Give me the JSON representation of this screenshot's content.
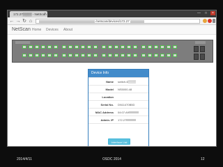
{
  "browser": {
    "tab_title": "172.27▒▒▒▒ - NetScan",
    "tab_close": "×",
    "window_controls": [
      "—",
      "□",
      "×"
    ],
    "back": "←",
    "forward": "→",
    "reload": "↻",
    "home": "⌂",
    "url": "/netscan/devices/172.27"
  },
  "navbar": {
    "brand": "NetScan",
    "links": [
      "Home",
      "Devices",
      "About"
    ]
  },
  "switch": {
    "left_label": "▒▒▒▒▒▒▒▒▒▒",
    "right_label": "▒▒▒▒▒▒▒"
  },
  "panel": {
    "title": "Device Info",
    "rows": [
      {
        "key": "Name",
        "value": "switch-6▒▒▒▒"
      },
      {
        "key": "Model",
        "value": "NS5000-48"
      },
      {
        "key": "Location",
        "value": ""
      },
      {
        "key": "Serial No.",
        "value": "DN11470B5D"
      },
      {
        "key": "MAC Address",
        "value": "04:07:A9"
      },
      {
        "key": "Admin. IP",
        "value": "172.27"
      }
    ],
    "button": "Interface List"
  },
  "footer": {
    "date": "2014/4/11",
    "conference": "OSDC 2014",
    "page": "12"
  },
  "colors": {
    "port_border": "#4fbf4a",
    "panel_head": "#428bca",
    "button": "#5bc0de"
  }
}
